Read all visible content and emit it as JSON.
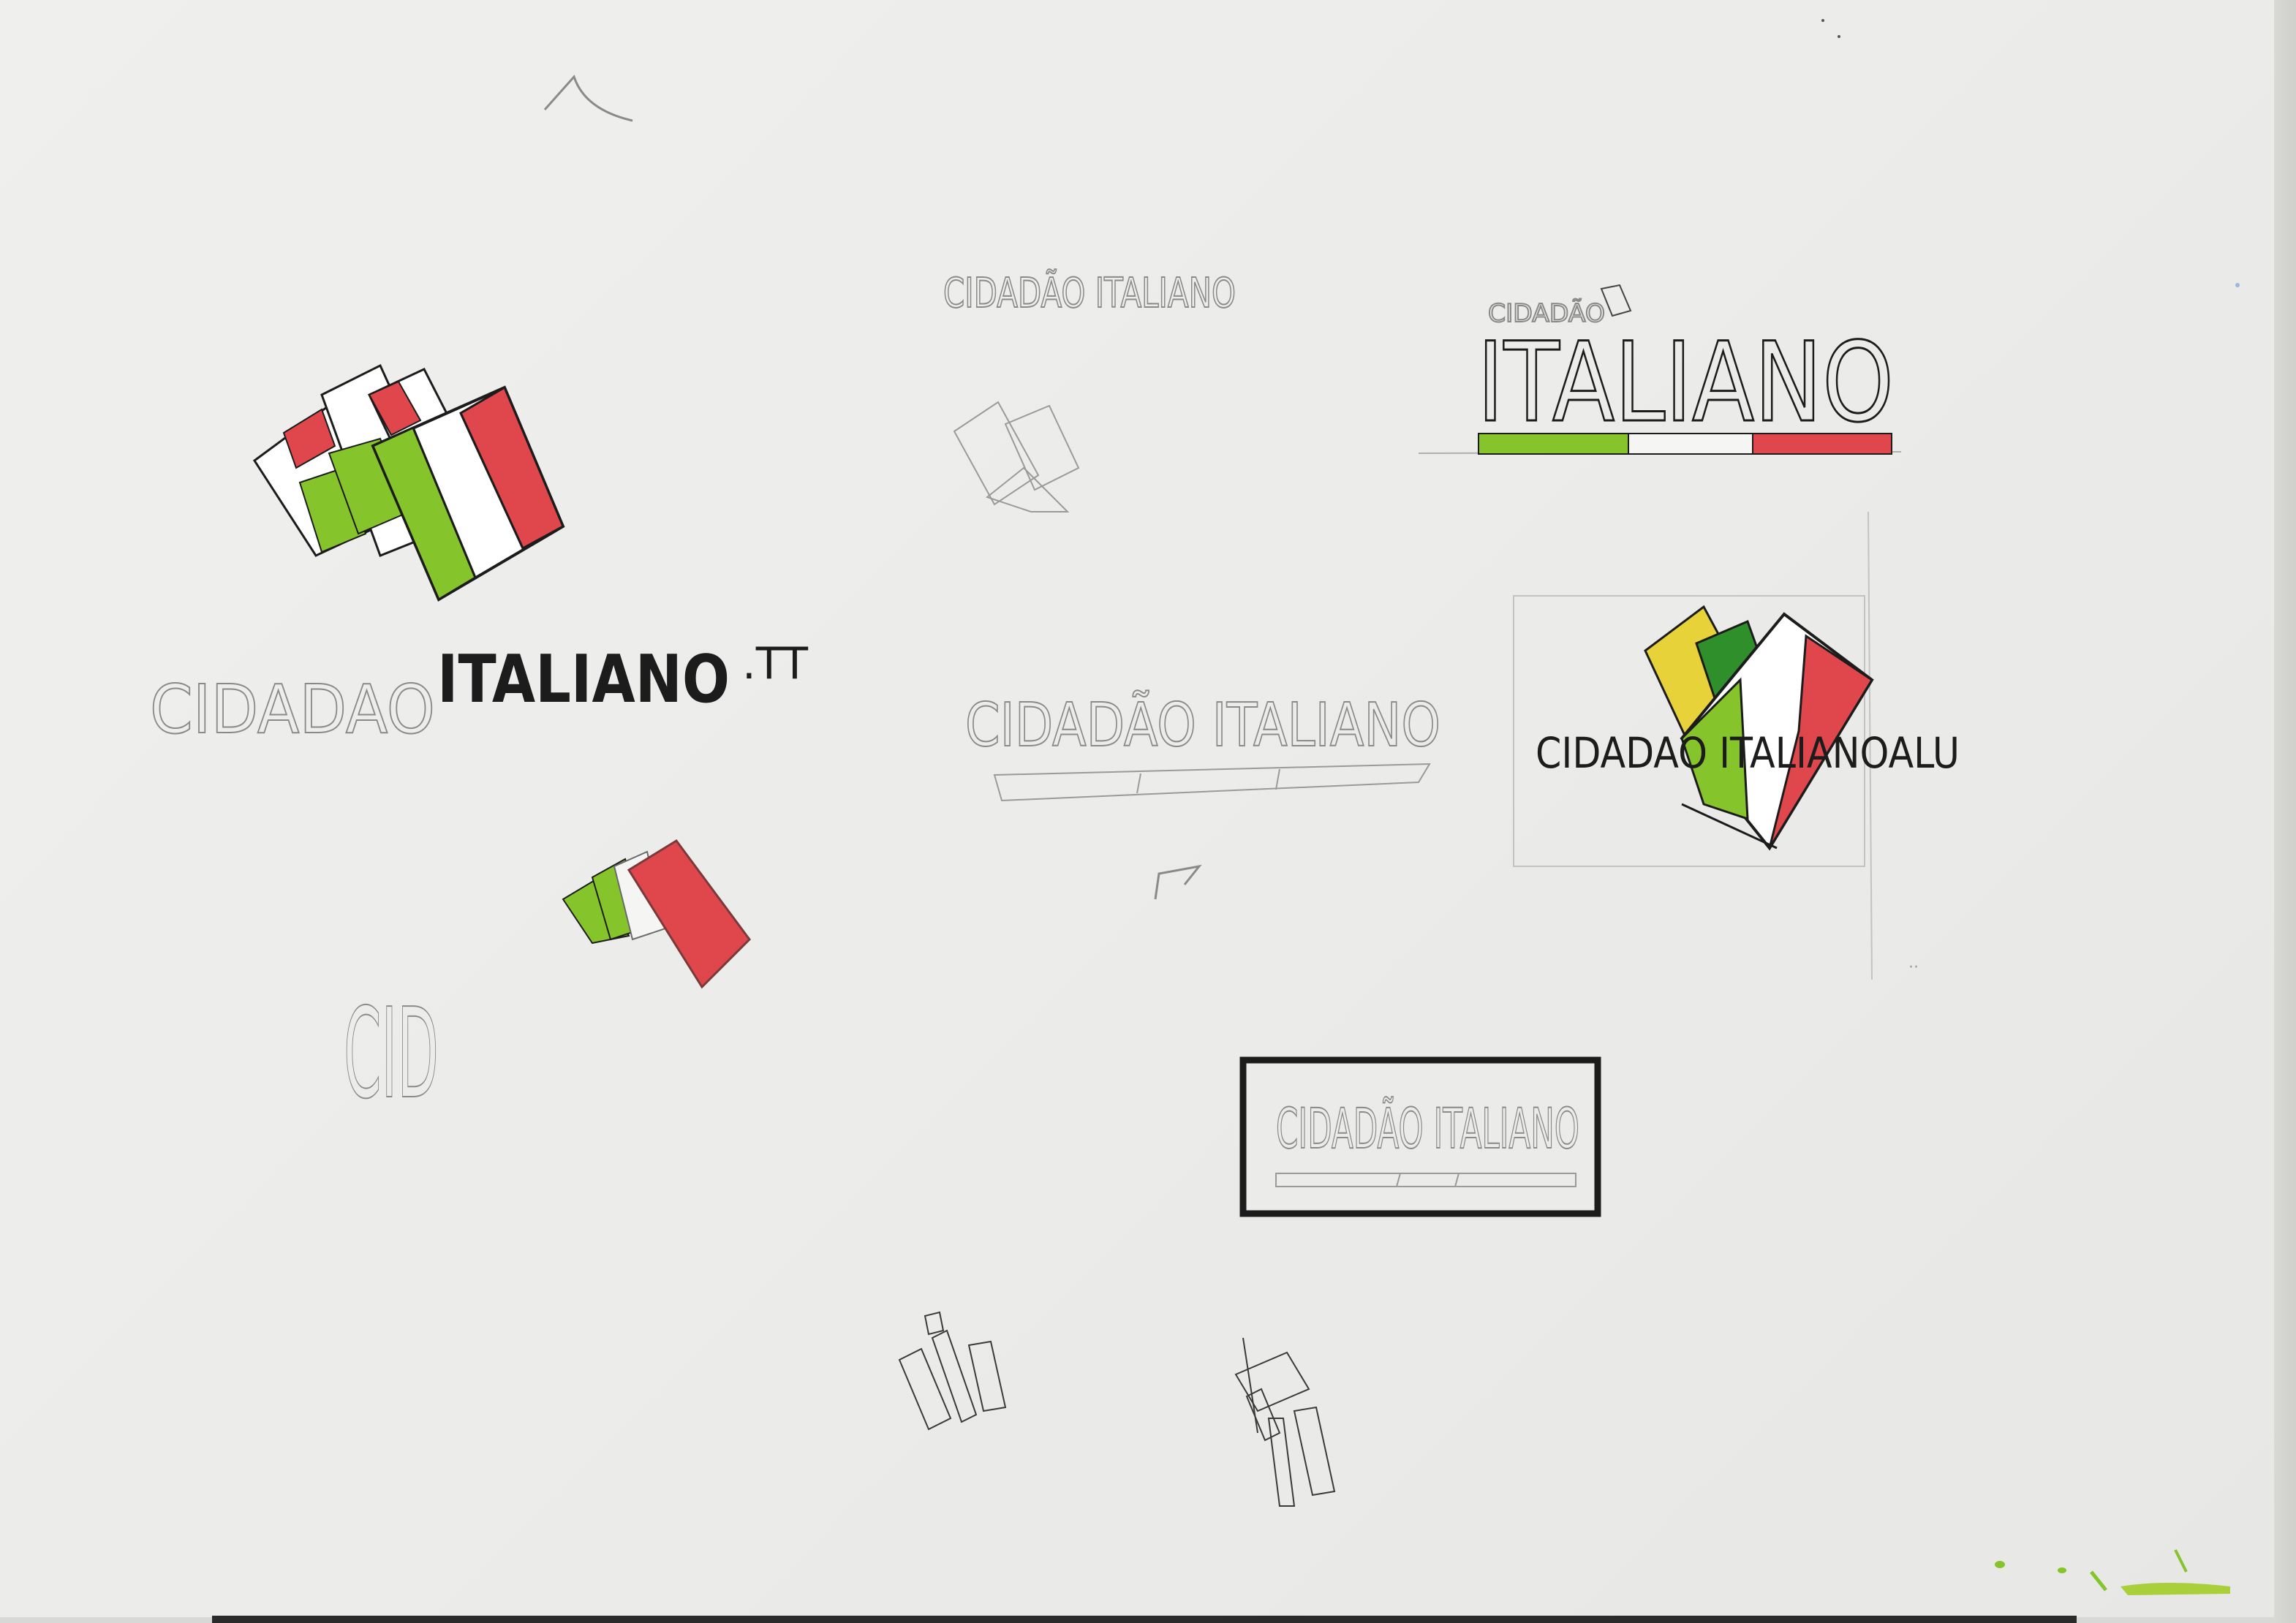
{
  "sketches": {
    "logo_main": {
      "part1": "CIDADAO",
      "part2": "ITALIANO",
      "suffix": ".TT"
    },
    "logo_top_center": "CIDADÃO ITALIANO",
    "logo_top_right": {
      "small": "CIDADÃO",
      "big": "ITALIANO"
    },
    "logo_middle_center": "CIDADÃO ITALIANO",
    "logo_right_shield": "CIDADAO ITALIANOALU",
    "logo_bottom_boxed": "CIDADÃO ITALIANO",
    "letters_fragment": "CID"
  },
  "palette": {
    "red": "#e0474c",
    "green": "#86c42c",
    "yellow": "#e8d23a",
    "dark_green": "#2f8f2a",
    "ink": "#1c1c1c",
    "pencil": "#8a8a8a",
    "paper": "#ececea"
  }
}
